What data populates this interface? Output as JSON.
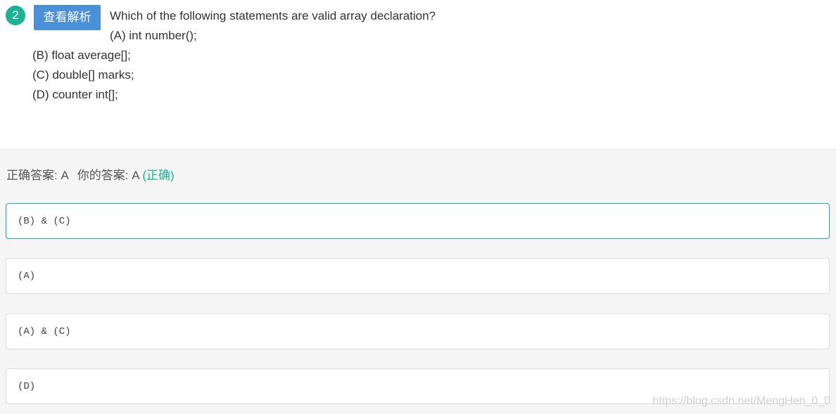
{
  "question": {
    "number": "2",
    "view_analysis_label": "查看解析",
    "text": "Which of the following statements are valid array declaration?",
    "statement_a": "(A) int number();",
    "statement_b": "(B) float average[];",
    "statement_c": "(C) double[] marks;",
    "statement_d": "(D) counter int[];"
  },
  "result": {
    "correct_label": "正确答案: A",
    "your_label": "你的答案: A",
    "status": "(正确)"
  },
  "options": [
    {
      "label": "(B) & (C)"
    },
    {
      "label": "(A)"
    },
    {
      "label": "(A) & (C)"
    },
    {
      "label": "(D)"
    }
  ],
  "watermark": "https://blog.csdn.net/MengHen_0_0",
  "colors": {
    "accent_green": "#1ab394",
    "button_blue": "#4a90d9"
  }
}
